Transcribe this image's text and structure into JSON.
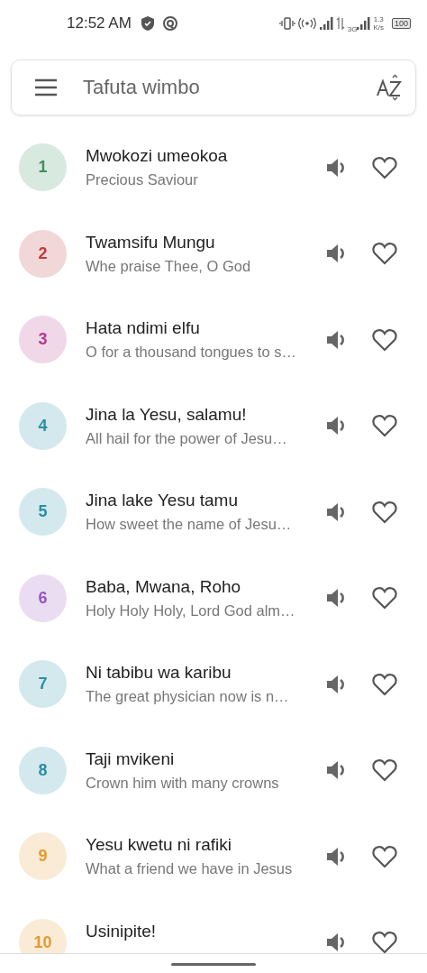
{
  "status_bar": {
    "time": "12:52 AM",
    "network_type": "3G",
    "speed_value": "1.3",
    "speed_unit": "K/s",
    "battery": "100"
  },
  "search": {
    "placeholder": "Tafuta wimbo"
  },
  "hymns": [
    {
      "number": "1",
      "title": "Mwokozi umeokoa",
      "subtitle": "Precious Saviour",
      "color": "#3d8f5f",
      "favorite": false
    },
    {
      "number": "2",
      "title": "Twamsifu Mungu",
      "subtitle": "Whe praise Thee, O God",
      "color": "#c0393b",
      "favorite": false
    },
    {
      "number": "3",
      "title": "Hata ndimi elfu",
      "subtitle": "O for a thousand tongues to s…",
      "color": "#b23a8c",
      "favorite": false
    },
    {
      "number": "4",
      "title": "Jina la Yesu, salamu!",
      "subtitle": "All hail for the power of Jesu…",
      "color": "#2a8fa3",
      "favorite": false
    },
    {
      "number": "5",
      "title": "Jina lake Yesu tamu",
      "subtitle": "How sweet the name of Jesu…",
      "color": "#2a8fa3",
      "favorite": false
    },
    {
      "number": "6",
      "title": "Baba, Mwana, Roho",
      "subtitle": "Holy Holy Holy, Lord God alm…",
      "color": "#9657c0",
      "favorite": false
    },
    {
      "number": "7",
      "title": "Ni tabibu wa karibu",
      "subtitle": "The great physician now is n…",
      "color": "#2a8fa3",
      "favorite": false
    },
    {
      "number": "8",
      "title": "Taji mvikeni",
      "subtitle": "Crown him with many crowns",
      "color": "#2a8fa3",
      "favorite": false
    },
    {
      "number": "9",
      "title": "Yesu kwetu ni rafiki",
      "subtitle": "What a friend we have in Jesus",
      "color": "#e39a2e",
      "favorite": false
    },
    {
      "number": "10",
      "title": "Usinipite!",
      "color": "#e39a2e",
      "favorite": false
    }
  ]
}
